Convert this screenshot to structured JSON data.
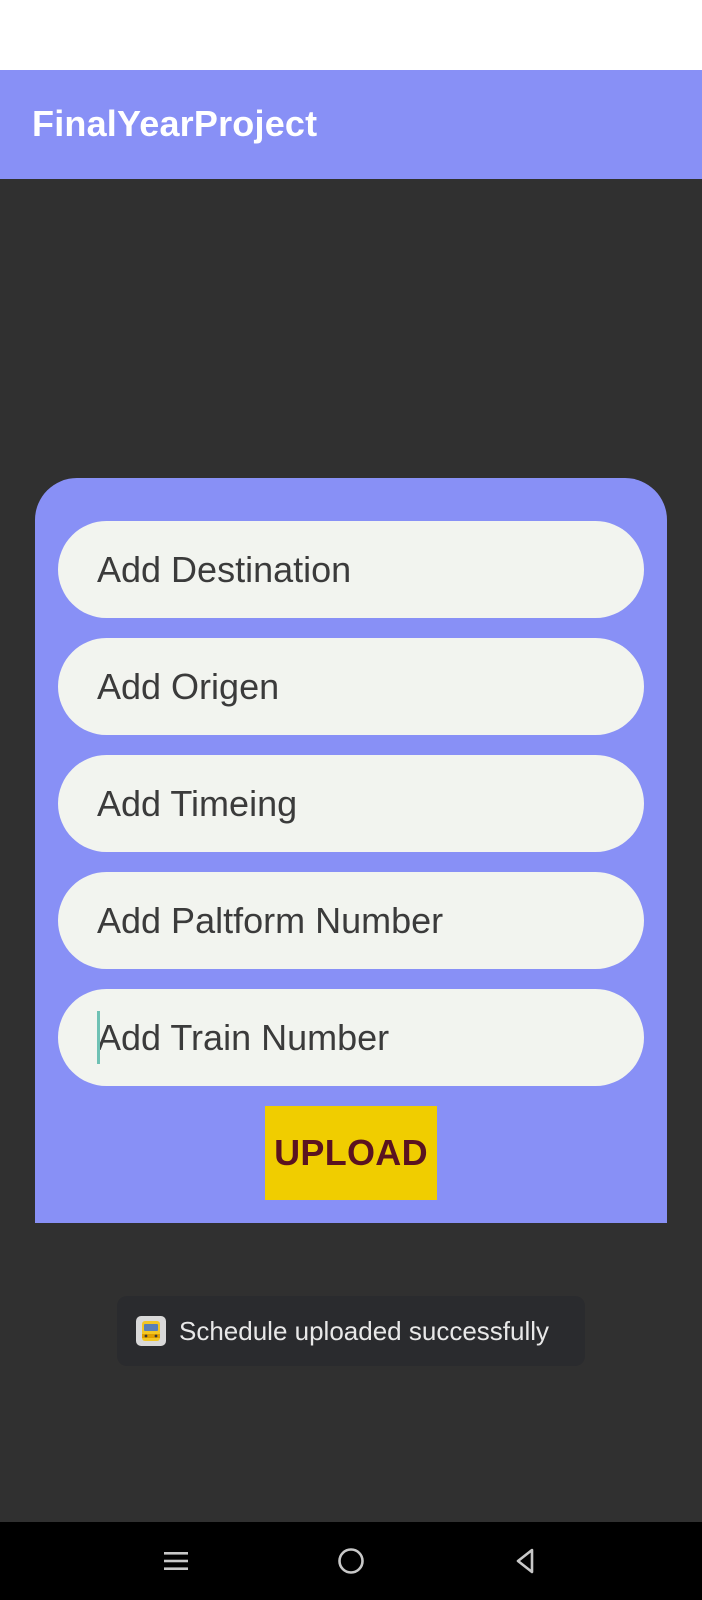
{
  "app": {
    "title": "FinalYearProject"
  },
  "form": {
    "destination_placeholder": "Add Destination",
    "origin_placeholder": "Add Origen",
    "timing_placeholder": "Add Timeing",
    "platform_placeholder": "Add Paltform Number",
    "train_number_placeholder": "Add Train Number",
    "upload_label": "UPLOAD"
  },
  "toast": {
    "icon": "app-icon",
    "message": "Schedule uploaded successfully"
  },
  "nav": {
    "items": [
      {
        "icon": "recent-apps-icon"
      },
      {
        "icon": "home-icon"
      },
      {
        "icon": "back-icon"
      }
    ]
  },
  "colors": {
    "accent": "#8890f6",
    "background": "#303030",
    "field": "#f2f4ef",
    "button": "#f0cd00",
    "button_text": "#5a1320"
  }
}
